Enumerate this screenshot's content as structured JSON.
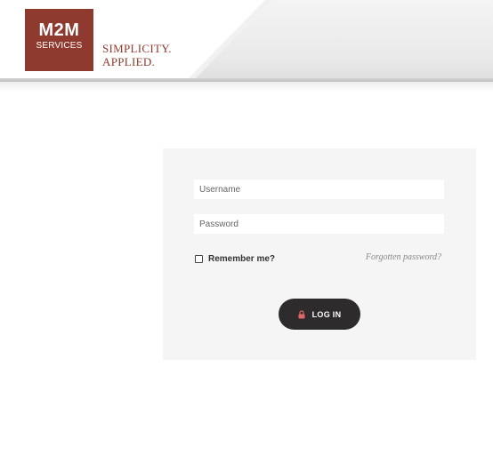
{
  "header": {
    "logo": {
      "main": "M2M",
      "sub": "SERVICES"
    },
    "tagline": [
      "SIMPLICITY.",
      "APPLIED."
    ]
  },
  "login": {
    "username_placeholder": "Username",
    "password_placeholder": "Password",
    "remember_label": "Remember me?",
    "remember_checked": false,
    "forgot_label": "Forgotten password?",
    "login_label": "LOG IN",
    "login_icon": "lock-icon"
  },
  "colors": {
    "brand": "#8e3a2e",
    "button": "#2d2b2b",
    "lock": "#e06666",
    "panel": "#f5f5f5"
  }
}
